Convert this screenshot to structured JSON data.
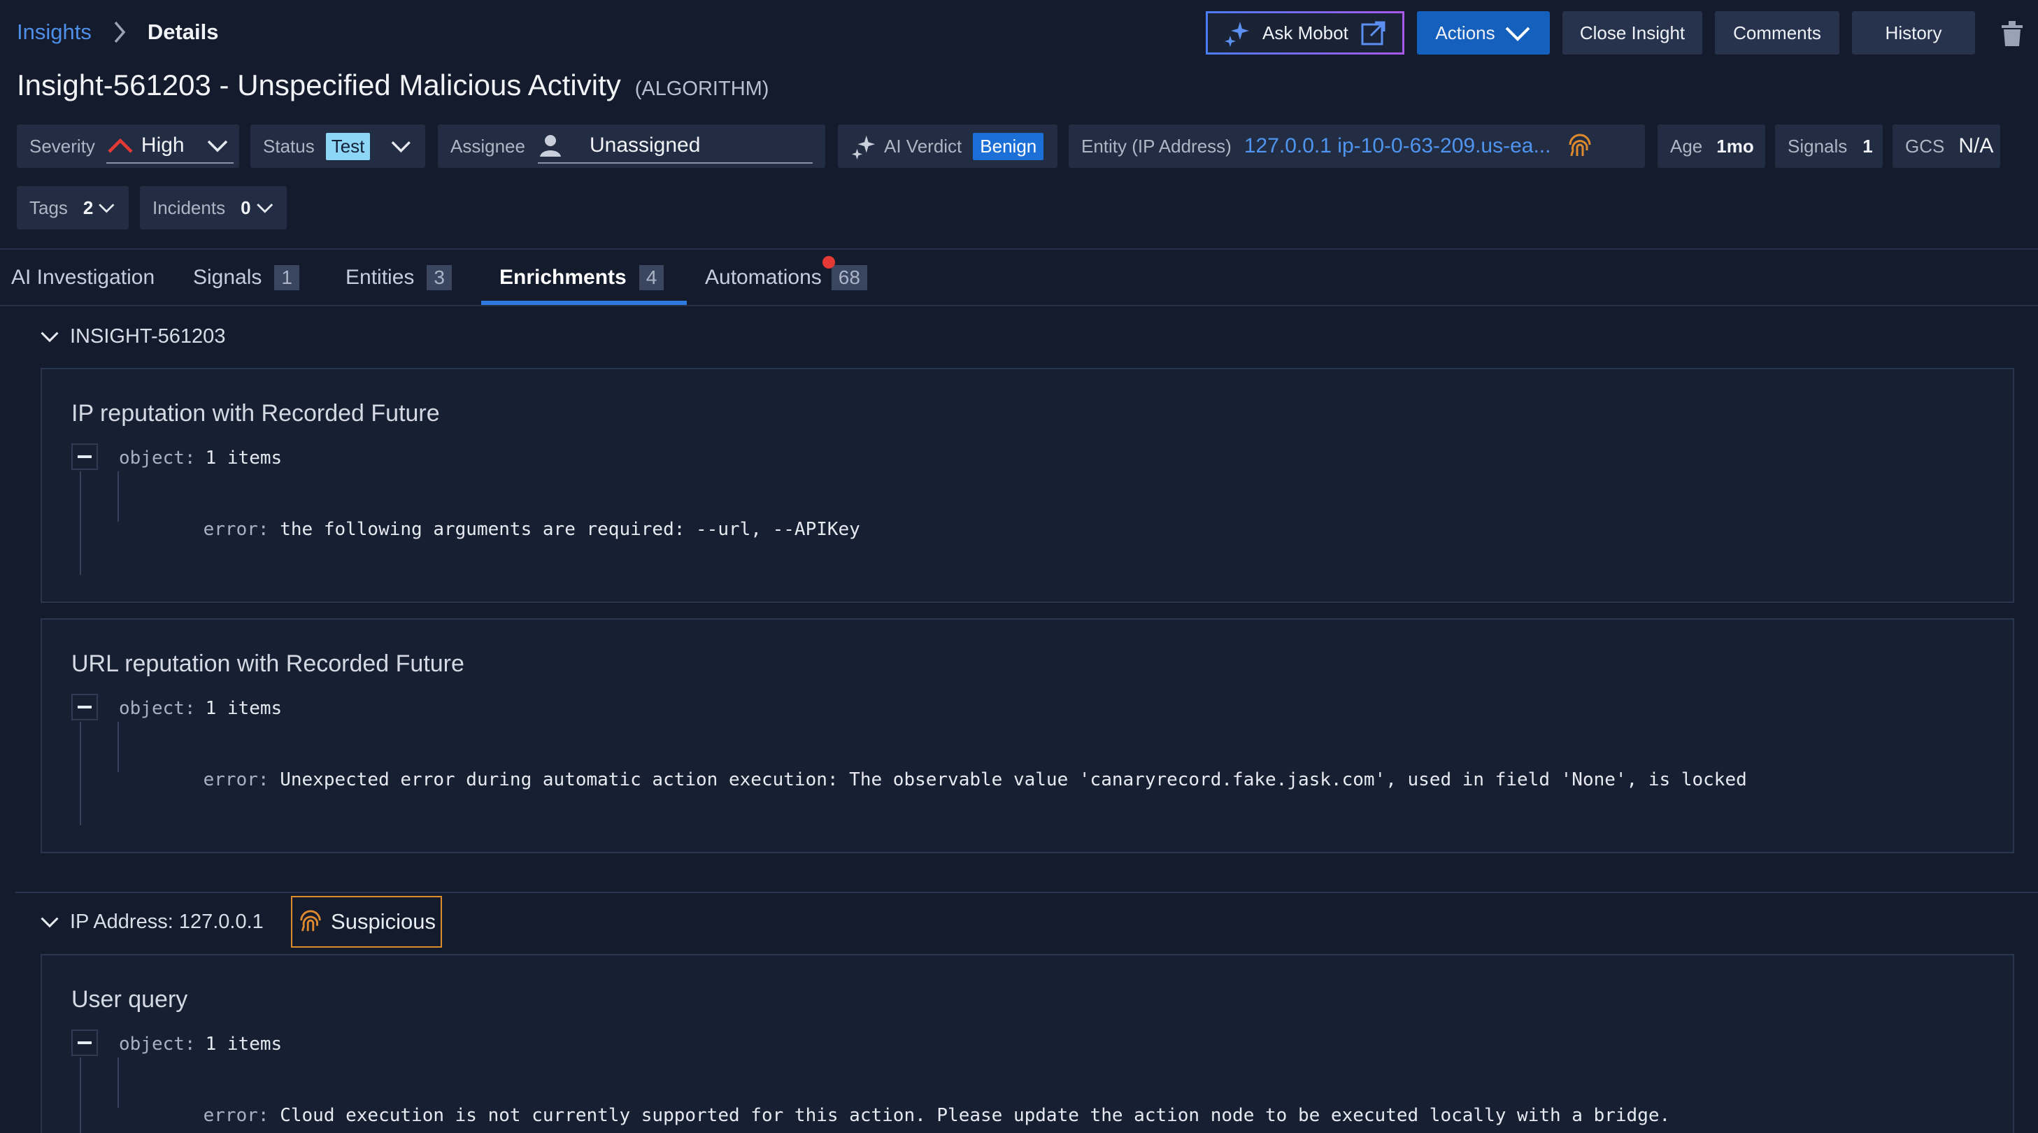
{
  "breadcrumb": {
    "root": "Insights",
    "current": "Details"
  },
  "toolbar": {
    "ask_mobot": "Ask Mobot",
    "actions": "Actions",
    "close_insight": "Close Insight",
    "comments": "Comments",
    "history": "History"
  },
  "insight": {
    "title": "Insight-561203 - Unspecified Malicious Activity",
    "tag": "(ALGORITHM)"
  },
  "fields": {
    "severity_label": "Severity",
    "severity_value": "High",
    "status_label": "Status",
    "status_value": "Test",
    "assignee_label": "Assignee",
    "assignee_value": "Unassigned",
    "verdict_label": "AI Verdict",
    "verdict_value": "Benign",
    "entity_label": "Entity (IP Address)",
    "entity_value": "127.0.0.1 ip-10-0-63-209.us-ea...",
    "age_label": "Age",
    "age_value": "1mo",
    "signals_label": "Signals",
    "signals_value": "1",
    "gcs_label": "GCS",
    "gcs_value": "N/A",
    "tags_label": "Tags",
    "tags_value": "2",
    "incidents_label": "Incidents",
    "incidents_value": "0"
  },
  "tabs": [
    {
      "label": "AI Investigation",
      "count": ""
    },
    {
      "label": "Signals",
      "count": "1"
    },
    {
      "label": "Entities",
      "count": "3"
    },
    {
      "label": "Enrichments",
      "count": "4"
    },
    {
      "label": "Automations",
      "count": "68"
    }
  ],
  "sections": [
    {
      "header": "INSIGHT-561203",
      "cards": [
        {
          "title": "IP reputation with Recorded Future",
          "object_label": "object:",
          "object_count": "1 items",
          "error_key": "error:",
          "error_text": "the following arguments are required: --url, --APIKey"
        },
        {
          "title": "URL reputation with Recorded Future",
          "object_label": "object:",
          "object_count": "1 items",
          "error_key": "error:",
          "error_text": "Unexpected error during automatic action execution: The observable value 'canaryrecord.fake.jask.com', used in field 'None', is locked"
        }
      ]
    },
    {
      "header": "IP Address: 127.0.0.1",
      "badge": "Suspicious",
      "cards": [
        {
          "title": "User query",
          "object_label": "object:",
          "object_count": "1 items",
          "error_key": "error:",
          "error_text": "Cloud execution is not currently supported for this action. Please update the action node to be executed locally with a bridge."
        }
      ]
    }
  ],
  "colors": {
    "accent": "#2e7ae0",
    "background": "#141b2d",
    "severity_high": "#e53935",
    "suspicious": "#e08a2e"
  }
}
